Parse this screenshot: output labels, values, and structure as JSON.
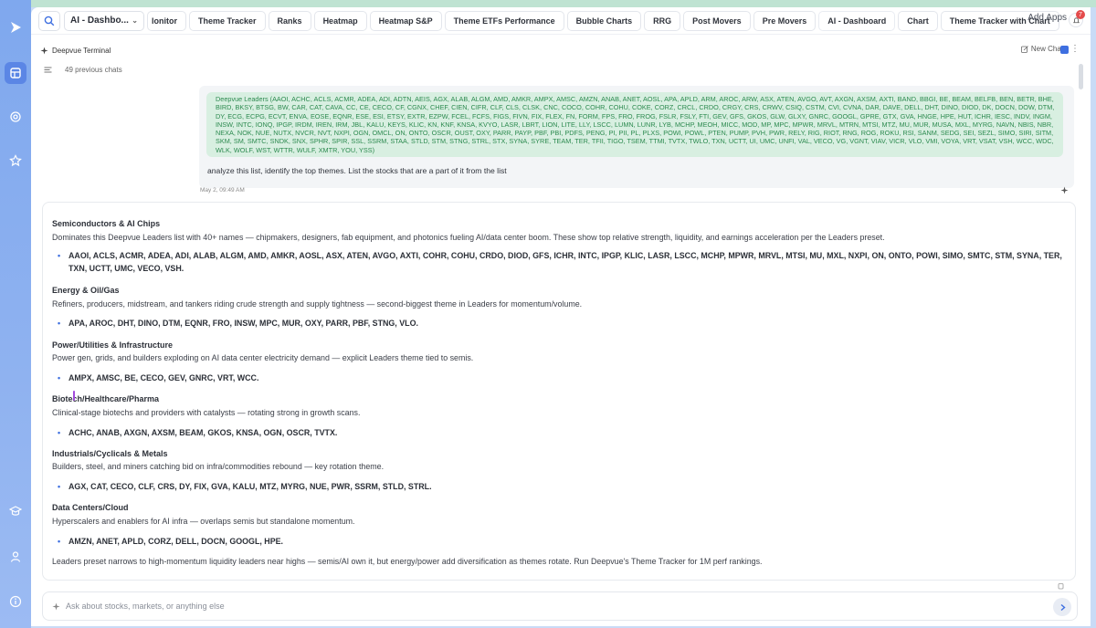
{
  "colors": {
    "accent": "#3e6fe0",
    "rail": "#8fb2f0",
    "ticker_text": "#2c8a4f",
    "ticker_bg": "#d8efe1",
    "badge": "#e44b4b"
  },
  "header": {
    "dashboard_select": "AI - Dashbo...",
    "tabs": [
      "lonitor",
      "Theme Tracker",
      "Ranks",
      "Heatmap",
      "Heatmap S&P",
      "Theme ETFs Performance",
      "Bubble Charts",
      "RRG",
      "Post Movers",
      "Pre Movers",
      "AI - Dashboard",
      "Chart",
      "Theme Tracker with Chart"
    ],
    "add_apps": "Add Apps",
    "notification_count": "7"
  },
  "panel": {
    "title": "Deepvue Terminal",
    "new_chat": "New Chat",
    "previous_chats": "49 previous chats"
  },
  "user_message": {
    "tickers": "Deepvue Leaders (AAOI, ACHC, ACLS, ACMR, ADEA, ADI, ADTN, AEIS, AGX, ALAB, ALGM, AMD, AMKR, AMPX, AMSC, AMZN, ANAB, ANET, AOSL, APA, APLD, ARM, AROC, ARW, ASX, ATEN, AVGO, AVT, AXGN, AXSM, AXTI, BAND, BBGI, BE, BEAM, BELFB, BEN, BETR, BHE, BIRD, BKSY, BTSG, BW, CAR, CAT, CAVA, CC, CE, CECO, CF, CGNX, CHEF, CIEN, CIFR, CLF, CLS, CLSK, CNC, COCO, COHR, COHU, COKE, CORZ, CRCL, CRDO, CRGY, CRS, CRWV, CSIQ, CSTM, CVI, CVNA, DAR, DAVE, DELL, DHT, DINO, DIOD, DK, DOCN, DOW, DTM, DY, ECG, ECPG, ECVT, ENVA, EOSE, EQNR, ESE, ESI, ETSY, EXTR, EZPW, FCEL, FCFS, FIGS, FIVN, FIX, FLEX, FN, FORM, FPS, FRO, FROG, FSLR, FSLY, FTI, GEV, GFS, GKOS, GLW, GLXY, GNRC, GOOGL, GPRE, GTX, GVA, HNGE, HPE, HUT, ICHR, IESC, INDV, INGM, INSW, INTC, IONQ, IPGP, IRDM, IREN, IRM, JBL, KALU, KEYS, KLIC, KN, KNF, KNSA, KVYO, LASR, LBRT, LION, LITE, LLY, LSCC, LUMN, LUNR, LYB, MCHP, MEOH, MICC, MOD, MP, MPC, MPWR, MRVL, MTRN, MTSI, MTZ, MU, MUR, MUSA, MXL, MYRG, NAVN, NBIS, NBR, NEXA, NOK, NUE, NUTX, NVCR, NVT, NXPI, OGN, OMCL, ON, ONTO, OSCR, OUST, OXY, PARR, PAYP, PBF, PBI, PDFS, PENG, PI, PII, PL, PLXS, POWI, POWL, PTEN, PUMP, PVH, PWR, RELY, RIG, RIOT, RNG, ROG, ROKU, RSI, SANM, SEDG, SEI, SEZL, SIMO, SIRI, SITM, SKM, SM, SMTC, SNDK, SNX, SPHR, SPIR, SSL, SSRM, STAA, STLD, STM, STNG, STRL, STX, SYNA, SYRE, TEAM, TER, TFII, TIGO, TSEM, TTMI, TVTX, TWLO, TXN, UCTT, UI, UMC, UNFI, VAL, VECO, VG, VGNT, VIAV, VICR, VLO, VMI, VOYA, VRT, VSAT, VSH, WCC, WDC, WLK, WOLF, WST, WTTR, WULF, XMTR, YOU, YSS)",
    "text": "analyze this list, identify the top themes. List the stocks that are a part of it from the list",
    "timestamp": "May 2, 09:49 AM"
  },
  "answer": {
    "sections": [
      {
        "title": "Semiconductors & AI Chips",
        "desc": "Dominates this Deepvue Leaders list with 40+ names — chipmakers, designers, fab equipment, and photonics fueling AI/data center boom. These show top relative strength, liquidity, and earnings acceleration per the Leaders preset.",
        "stocks": "AAOI, ACLS, ACMR, ADEA, ADI, ALAB, ALGM, AMD, AMKR, AOSL, ASX, ATEN, AVGO, AXTI, COHR, COHU, CRDO, DIOD, GFS, ICHR, INTC, IPGP, KLIC, LASR, LSCC, MCHP, MPWR, MRVL, MTSI, MU, MXL, NXPI, ON, ONTO, POWI, SIMO, SMTC, STM, SYNA, TER, TXN, UCTT, UMC, VECO, VSH."
      },
      {
        "title": "Energy & Oil/Gas",
        "desc": "Refiners, producers, midstream, and tankers riding crude strength and supply tightness — second-biggest theme in Leaders for momentum/volume.",
        "stocks": "APA, AROC, DHT, DINO, DTM, EQNR, FRO, INSW, MPC, MUR, OXY, PARR, PBF, STNG, VLO."
      },
      {
        "title": "Power/Utilities & Infrastructure",
        "desc": "Power gen, grids, and builders exploding on AI data center electricity demand — explicit Leaders theme tied to semis.",
        "stocks": "AMPX, AMSC, BE, CECO, GEV, GNRC, VRT, WCC."
      },
      {
        "title": "Biotech/Healthcare/Pharma",
        "desc": "Clinical-stage biotechs and providers with catalysts — rotating strong in growth scans.",
        "stocks": "ACHC, ANAB, AXGN, AXSM, BEAM, GKOS, KNSA, OGN, OSCR, TVTX."
      },
      {
        "title": "Industrials/Cyclicals & Metals",
        "desc": "Builders, steel, and miners catching bid on infra/commodities rebound — key rotation theme.",
        "stocks": "AGX, CAT, CECO, CLF, CRS, DY, FIX, GVA, KALU, MTZ, MYRG, NUE, PWR, SSRM, STLD, STRL."
      },
      {
        "title": "Data Centers/Cloud",
        "desc": "Hyperscalers and enablers for AI infra — overlaps semis but standalone momentum.",
        "stocks": "AMZN, ANET, APLD, CORZ, DELL, DOCN, GOOGL, HPE."
      }
    ],
    "summary": "Leaders preset narrows to high-momentum liquidity leaders near highs — semis/AI own it, but energy/power add diversification as themes rotate. Run Deepvue's Theme Tracker for 1M perf rankings."
  },
  "input": {
    "placeholder": "Ask about stocks, markets, or anything else"
  }
}
